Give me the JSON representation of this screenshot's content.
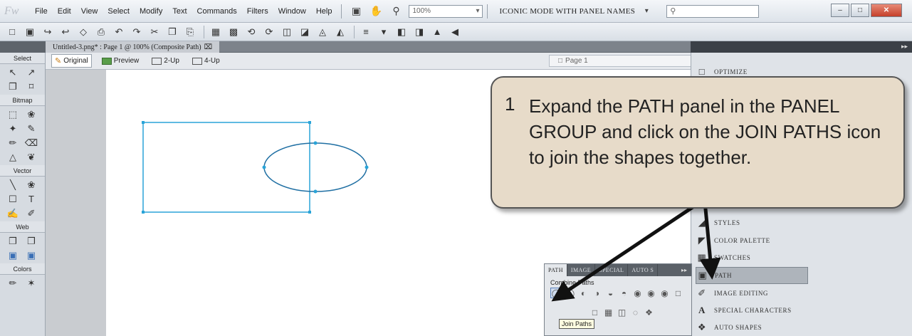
{
  "menubar": {
    "logo": "Fw",
    "items": [
      "File",
      "Edit",
      "View",
      "Select",
      "Modify",
      "Text",
      "Commands",
      "Filters",
      "Window",
      "Help"
    ],
    "zoom": "100%",
    "workspace": "ICONIC MODE WITH PANEL NAMES",
    "window_controls": [
      "–",
      "□",
      "✕"
    ]
  },
  "document": {
    "tab_title": "Untitled-3.png* : Page 1 @ 100% (Composite Path)",
    "views": [
      "Original",
      "Preview",
      "2-Up",
      "4-Up"
    ],
    "page": "Page 1"
  },
  "tools": {
    "sections": [
      {
        "label": "Select",
        "icons": [
          "↖",
          "↗",
          "❐",
          "⌑"
        ]
      },
      {
        "label": "Bitmap",
        "icons": [
          "⬚",
          "❀",
          "✦",
          "✎",
          "✏",
          "⌫",
          "△",
          "❦"
        ]
      },
      {
        "label": "Vector",
        "icons": [
          "╲",
          "❀",
          "☐",
          "T",
          "✍",
          "✐"
        ]
      },
      {
        "label": "Web",
        "icons": [
          "❐",
          "❐",
          "▣",
          "▣"
        ]
      },
      {
        "label": "Colors",
        "icons": [
          "✏",
          "✶"
        ]
      }
    ]
  },
  "panels": {
    "items": [
      {
        "label": "OPTIMIZE",
        "icon": "optimize-icon"
      },
      {
        "label": "STYLES",
        "icon": "styles-icon"
      },
      {
        "label": "COLOR PALETTE",
        "icon": "color-palette-icon"
      },
      {
        "label": "SWATCHES",
        "icon": "swatches-icon"
      },
      {
        "label": "PATH",
        "icon": "path-icon"
      },
      {
        "label": "IMAGE EDITING",
        "icon": "image-editing-icon"
      },
      {
        "label": "SPECIAL CHARACTERS",
        "icon": "special-characters-icon"
      },
      {
        "label": "AUTO SHAPES",
        "icon": "auto-shapes-icon"
      }
    ]
  },
  "path_panel": {
    "tabs": [
      "PATH",
      "IMAGE",
      "SPECIAL",
      "AUTO S"
    ],
    "section": "Combine Paths",
    "tooltip": "Join Paths"
  },
  "callout": {
    "number": "1",
    "text": "Expand the PATH panel in the PANEL GROUP and click on the JOIN PATHS icon to join the shapes together."
  },
  "colors": {
    "path_stroke": "#2aa4d8",
    "callout_bg": "#e7dbc9",
    "selected_panel": "#aeb4bb"
  }
}
